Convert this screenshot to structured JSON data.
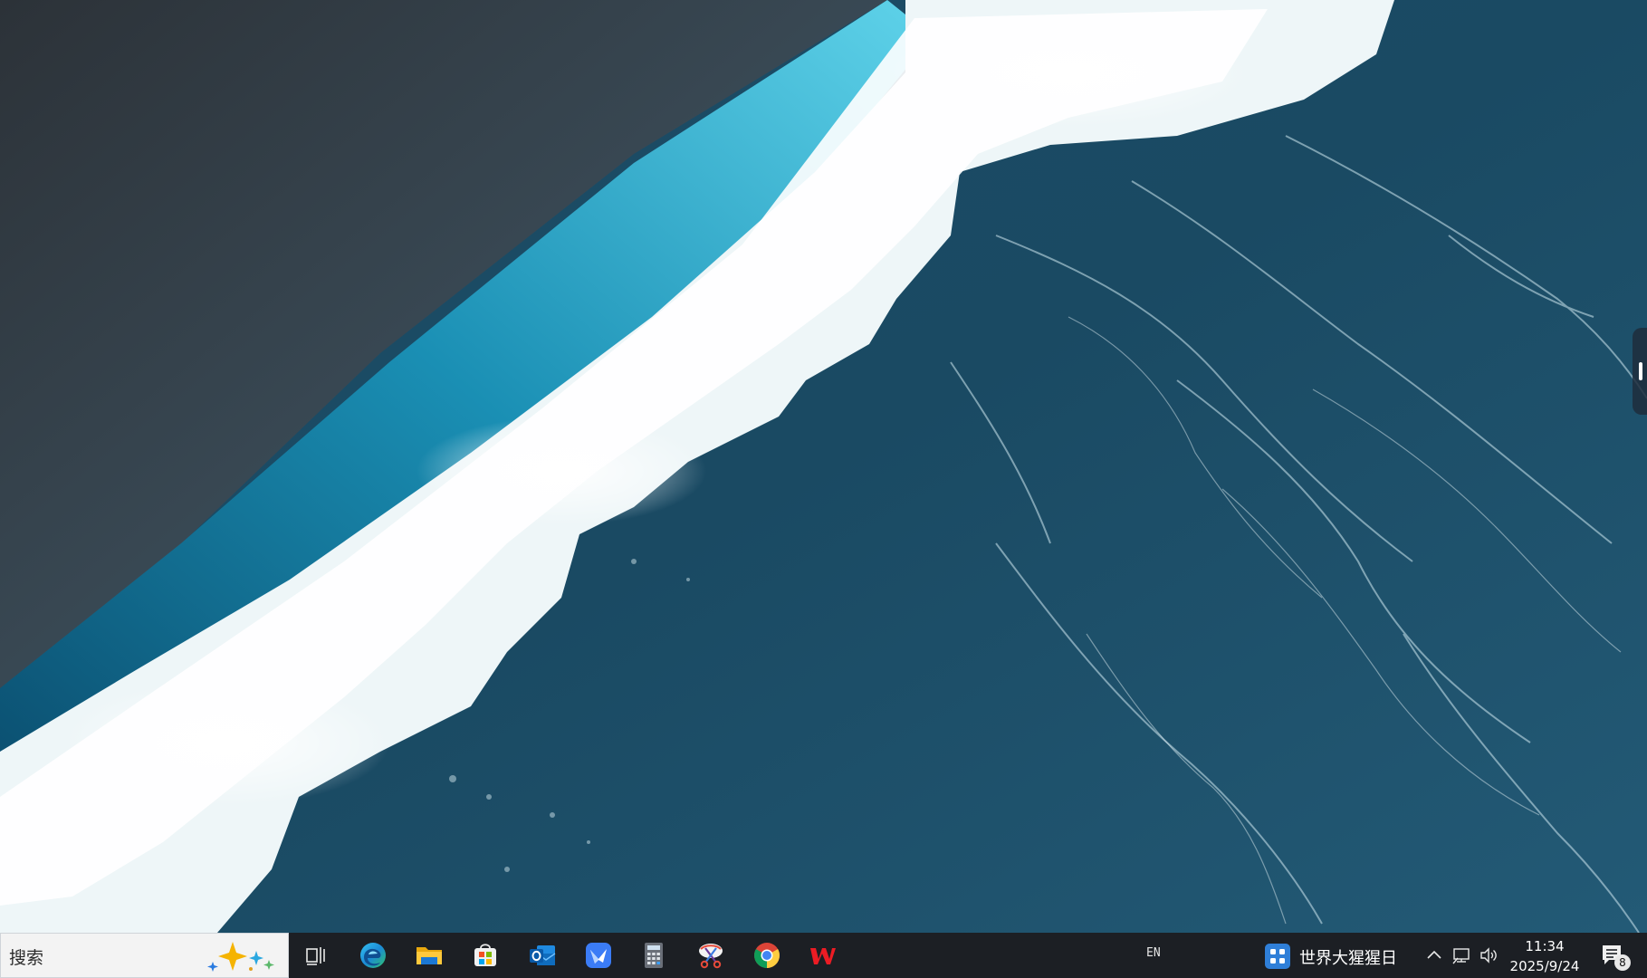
{
  "taskbar": {
    "search": {
      "label": "搜索"
    },
    "pinned_apps": [
      {
        "name": "task-view",
        "icon": "task-view-icon"
      },
      {
        "name": "microsoft-edge",
        "icon": "edge-icon"
      },
      {
        "name": "file-explorer",
        "icon": "folder-icon"
      },
      {
        "name": "microsoft-store",
        "icon": "store-icon"
      },
      {
        "name": "outlook",
        "icon": "outlook-icon"
      },
      {
        "name": "feishu",
        "icon": "feishu-icon"
      },
      {
        "name": "calculator",
        "icon": "calculator-icon"
      },
      {
        "name": "snipping-tool",
        "icon": "scissors-icon"
      },
      {
        "name": "google-chrome",
        "icon": "chrome-icon"
      },
      {
        "name": "wps-office",
        "icon": "wps-icon"
      }
    ],
    "language": "EN",
    "widget": {
      "text": "世界大猩猩日",
      "icon": "widget-grid-icon"
    },
    "tray": [
      "chevron-up-icon",
      "network-icon",
      "volume-icon"
    ],
    "clock": {
      "time": "11:34",
      "date": "2025/9/24"
    },
    "notifications": {
      "count": "8"
    }
  },
  "colors": {
    "taskbar_bg": "#1c1f24",
    "search_bg": "#f3f3f3",
    "accent": "#2f7fd8"
  }
}
